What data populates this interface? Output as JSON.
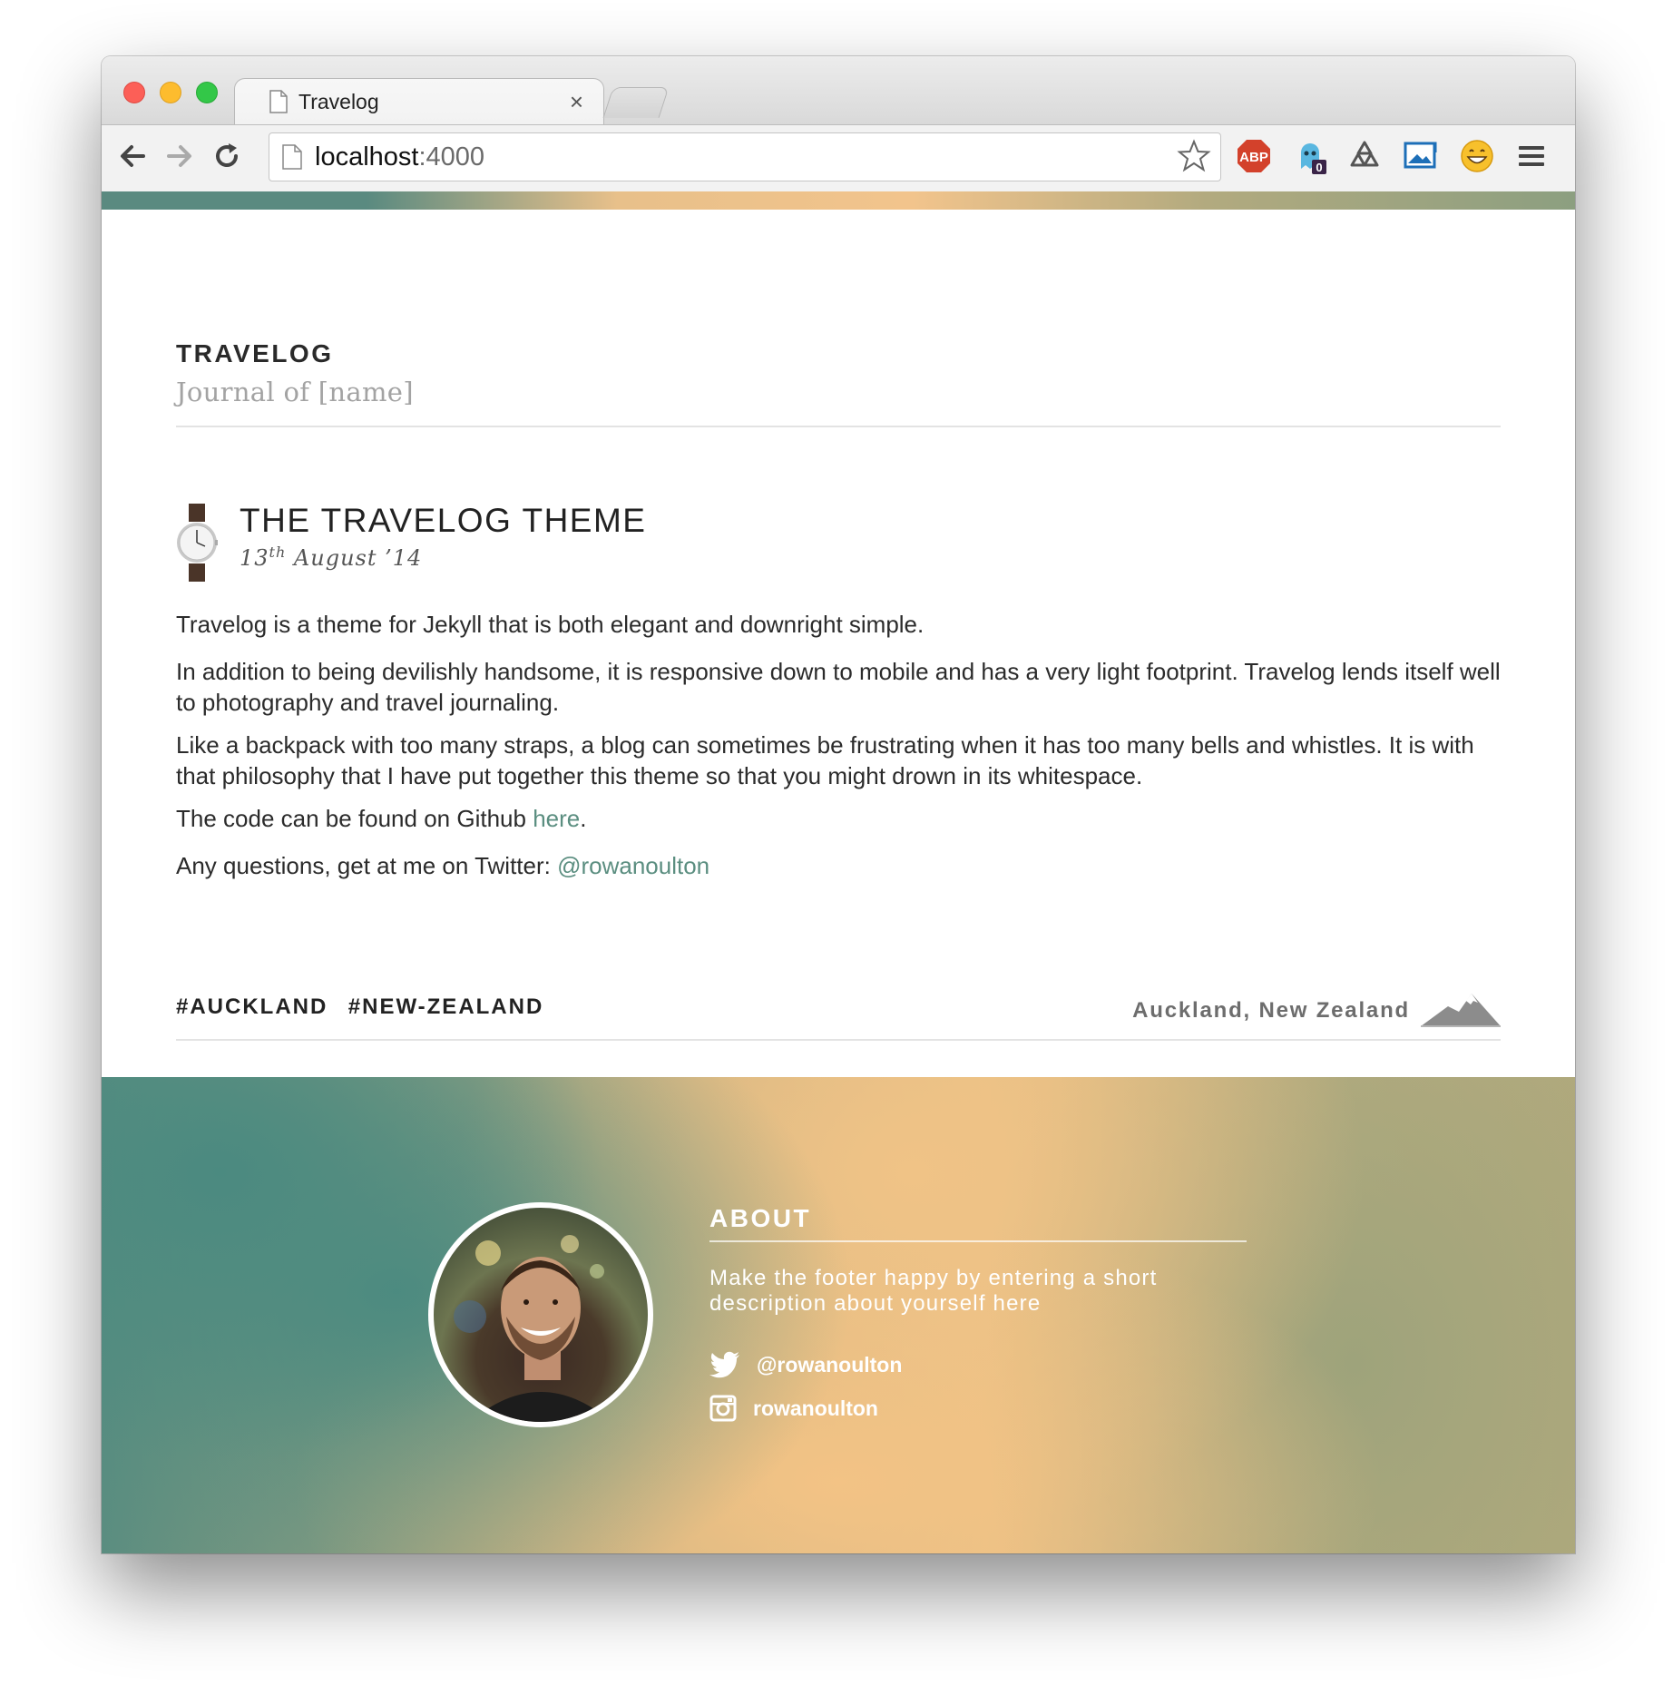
{
  "browser": {
    "tab_title": "Travelog",
    "tab_close": "×",
    "url_host": "localhost",
    "url_port": ":4000",
    "extensions": [
      "adblock-plus-icon",
      "ghostery-icon",
      "recycle-icon",
      "screenshot-icon",
      "emoji-icon",
      "menu-icon"
    ],
    "adblock_label": "ABP",
    "ghostery_badge": "0"
  },
  "site": {
    "title": "TRAVELOG",
    "subtitle": "Journal of [name]"
  },
  "post": {
    "title": "THE TRAVELOG THEME",
    "date_day": "13",
    "date_suffix": "th",
    "date_rest": " August ’14",
    "paragraphs": [
      "Travelog is a theme for Jekyll that is both elegant and downright simple.",
      "In addition to being devilishly handsome, it is responsive down to mobile and has a very light footprint. Travelog lends itself well to photography and travel journaling.",
      "Like a backpack with too many straps, a blog can sometimes be frustrating when it has too many bells and whistles. It is with that philosophy that I have put together this theme so that you might drown in its whitespace."
    ],
    "github_prefix": "The code can be found on Github ",
    "github_link": "here",
    "github_suffix": ".",
    "twitter_prefix": "Any questions, get at me on Twitter: ",
    "twitter_link": "@rowanoulton",
    "tags": [
      "#AUCKLAND",
      "#NEW-ZEALAND"
    ],
    "location": "Auckland, New Zealand"
  },
  "footer": {
    "about_title": "ABOUT",
    "about_desc": "Make the footer happy by entering a short description about yourself here",
    "twitter_handle": "@rowanoulton",
    "instagram_handle": "rowanoulton"
  },
  "colors": {
    "link": "#5b8e80",
    "footer_teal": "#4b8a80",
    "footer_sand": "#f3c385"
  }
}
